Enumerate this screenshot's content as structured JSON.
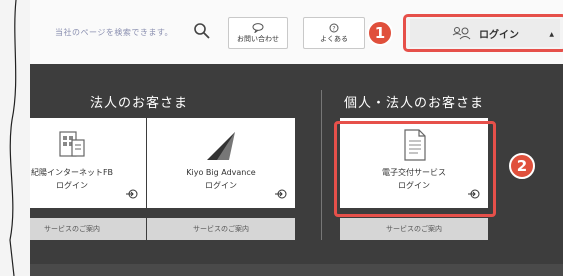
{
  "header": {
    "search_placeholder": "当社のページを検索できます。",
    "contact_label": "お問い合わせ",
    "faq_label": "よくある",
    "login_label": "ログイン"
  },
  "panel": {
    "corporate_title": "法人のお客さま",
    "personal_title": "個人・法人のお客さま",
    "cards": [
      {
        "line1": "紀陽インターネットFB",
        "line2": "ログイン",
        "service": "サービスのご案内"
      },
      {
        "line1": "Kiyo Big Advance",
        "line2": "ログイン",
        "service": "サービスのご案内"
      },
      {
        "line1": "電子交付サービス",
        "line2": "ログイン",
        "service": "サービスのご案内"
      }
    ]
  },
  "badges": {
    "one": "1",
    "two": "2"
  },
  "colors": {
    "accent": "#e6504a",
    "badge": "#e0503c",
    "panel": "#3d3d3d"
  }
}
